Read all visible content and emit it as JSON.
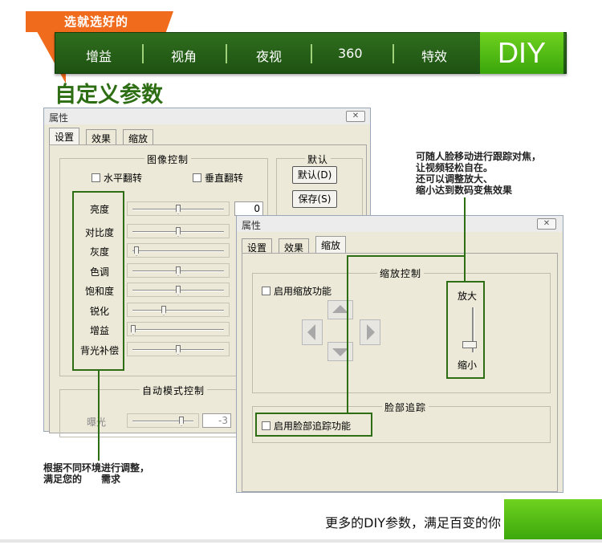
{
  "banner": {
    "tag": "选就选好的",
    "nav": [
      "增益",
      "视角",
      "夜视",
      "360",
      "特效"
    ],
    "active": "DIY"
  },
  "page_title": "自定义参数",
  "window1": {
    "title": "属性",
    "close": "✕",
    "tabs": [
      "设置",
      "效果",
      "缩放"
    ],
    "image_group": "图像控制",
    "flip_h": "水平翻转",
    "flip_v": "垂直翻转",
    "default_group": "默认",
    "default_btn": "默认(D)",
    "save_btn": "保存(S)",
    "sliders": [
      {
        "label": "亮度",
        "value": "0"
      },
      {
        "label": "对比度",
        "value": ""
      },
      {
        "label": "灰度",
        "value": ""
      },
      {
        "label": "色调",
        "value": ""
      },
      {
        "label": "饱和度",
        "value": ""
      },
      {
        "label": "锐化",
        "value": ""
      },
      {
        "label": "增益",
        "value": ""
      },
      {
        "label": "背光补偿",
        "value": ""
      }
    ],
    "auto_group": "自动模式控制",
    "exposure_label": "曝光",
    "exposure_value": "-3"
  },
  "window2": {
    "title": "属性",
    "close": "✕",
    "tabs": [
      "设置",
      "效果",
      "缩放"
    ],
    "zoom_group": "缩放控制",
    "enable_zoom": "启用缩放功能",
    "zoom_in": "放大",
    "zoom_out": "缩小",
    "face_group": "脸部追踪",
    "enable_face": "启用脸部追踪功能"
  },
  "notes": {
    "right": [
      "可随人脸移动进行跟踪对焦，",
      "让视频轻松自在。",
      "还可以调整放大、",
      "缩小达到数码变焦效果"
    ],
    "left": [
      "根据不同环境进行调整，",
      "满足您的　　需求"
    ]
  },
  "footer": "更多的DIY参数，满足百变的你",
  "colors": {
    "green": "#2d6d13",
    "orange": "#f06b1c",
    "lime": "#5cc219"
  }
}
